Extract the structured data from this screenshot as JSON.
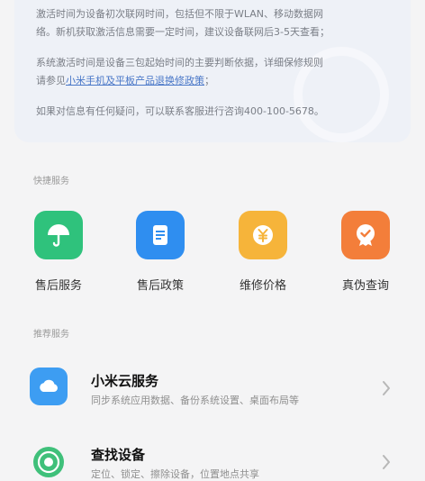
{
  "info": {
    "line1": "激活时间为设备初次联网时间，包括但不限于WLAN、移动数据网",
    "line2": "络。新机获取激活信息需要一定时间，建议设备联网后3-5天查看；",
    "line3": "系统激活时间是设备三包起始时间的主要判断依据，详细保修规则",
    "line4_prefix": "请参见",
    "line4_link": "小米手机及平板产品退换修政策",
    "line4_suffix": "；",
    "line5": "如果对信息有任何疑问，可以联系客服进行咨询400-100-5678。"
  },
  "quick_services": {
    "title": "快捷服务",
    "items": [
      {
        "label": "售后服务",
        "icon": "umbrella-icon",
        "color": "#2fc27c"
      },
      {
        "label": "售后政策",
        "icon": "document-icon",
        "color": "#2f8ef0"
      },
      {
        "label": "维修价格",
        "icon": "yen-coin-icon",
        "color": "#f6b43a"
      },
      {
        "label": "真伪查询",
        "icon": "verify-badge-icon",
        "color": "#f37e3a"
      }
    ]
  },
  "recommended": {
    "title": "推荐服务",
    "items": [
      {
        "title": "小米云服务",
        "subtitle": "同步系统应用数据、备份系统设置、桌面布局等",
        "icon": "cloud-icon",
        "color": "#3d9df2"
      },
      {
        "title": "查找设备",
        "subtitle": "定位、锁定、擦除设备，位置地点共享",
        "icon": "radar-icon",
        "color": "#3fc07a"
      }
    ]
  }
}
